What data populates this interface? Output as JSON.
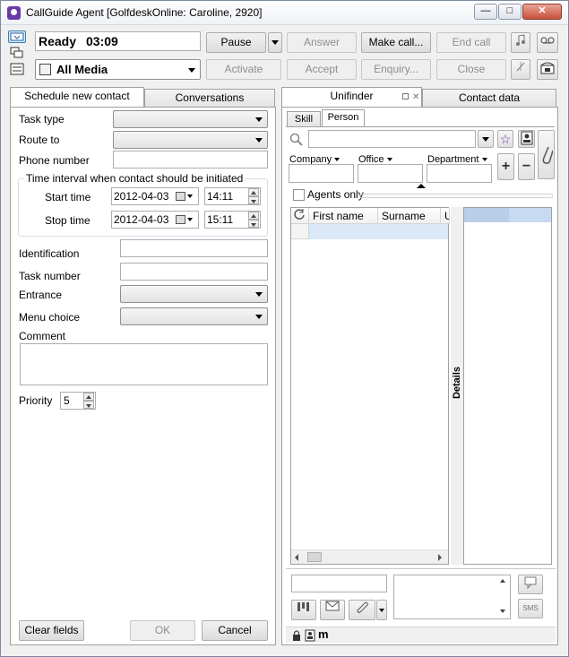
{
  "window": {
    "title": "CallGuide Agent [GolfdeskOnline: Caroline, 2920]",
    "minimize_glyph": "—",
    "maximize_glyph": "□",
    "close_glyph": "✕"
  },
  "toolbar": {
    "status": "Ready",
    "timer": "03:09",
    "media": "All Media",
    "pause": "Pause",
    "answer": "Answer",
    "make_call": "Make call...",
    "end_call": "End call",
    "activate": "Activate",
    "accept": "Accept",
    "enquiry": "Enquiry...",
    "close": "Close"
  },
  "left_panel": {
    "tabs": [
      "Schedule new contact",
      "Conversations"
    ],
    "task_type_label": "Task type",
    "route_to_label": "Route to",
    "phone_number_label": "Phone number",
    "time_interval_legend": "Time interval when contact should be initiated",
    "start_time_label": "Start time",
    "start_date": "2012-04-03",
    "start_clock": "14:11",
    "stop_time_label": "Stop time",
    "stop_date": "2012-04-03",
    "stop_clock": "15:11",
    "identification_label": "Identification",
    "task_number_label": "Task number",
    "entrance_label": "Entrance",
    "menu_choice_label": "Menu choice",
    "comment_label": "Comment",
    "priority_label": "Priority",
    "priority_value": "5",
    "clear_fields": "Clear fields",
    "ok": "OK",
    "cancel": "Cancel"
  },
  "right_panel": {
    "tabs": [
      "Unifinder",
      "Contact data"
    ],
    "subtabs": [
      "Skill",
      "Person"
    ],
    "company_label": "Company",
    "office_label": "Office",
    "department_label": "Department",
    "agents_only_label": "Agents only",
    "columns": [
      "First name",
      "Surname",
      "U"
    ],
    "details_label": "Details",
    "sms_label": "SMS",
    "m_label": "m"
  }
}
